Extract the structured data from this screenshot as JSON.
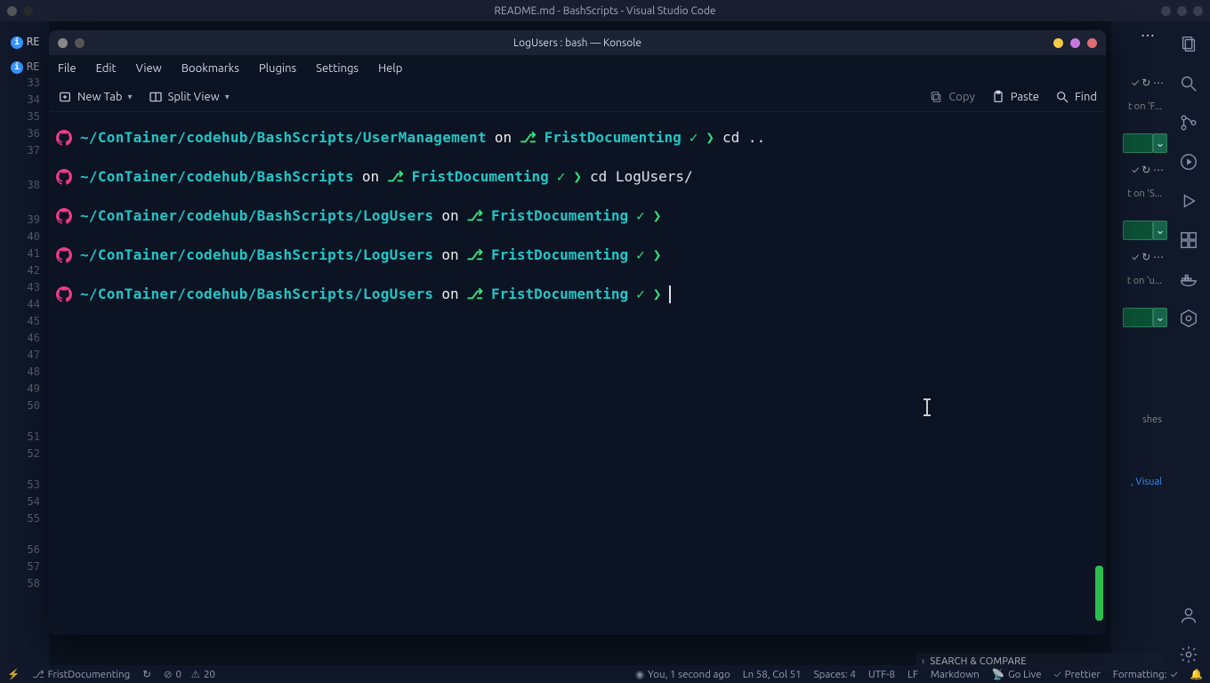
{
  "vscode": {
    "title": "README.md - BashScripts - Visual Studio Code",
    "tab1": "RE",
    "tab2": "RE",
    "more": "⋯"
  },
  "konsole": {
    "title": "LogUsers : bash — Konsole",
    "menu": [
      "File",
      "Edit",
      "View",
      "Bookmarks",
      "Plugins",
      "Settings",
      "Help"
    ],
    "toolbar": {
      "newtab": "New Tab",
      "split": "Split View",
      "copy": "Copy",
      "paste": "Paste",
      "find": "Find"
    },
    "prompts": [
      {
        "path": "~/ConTainer/codehub/BashScripts/UserManagement",
        "branch": "FristDocumenting",
        "cmd": "cd .."
      },
      {
        "path": "~/ConTainer/codehub/BashScripts",
        "branch": "FristDocumenting",
        "cmd": "cd LogUsers/"
      },
      {
        "path": "~/ConTainer/codehub/BashScripts/LogUsers",
        "branch": "FristDocumenting",
        "cmd": ""
      },
      {
        "path": "~/ConTainer/codehub/BashScripts/LogUsers",
        "branch": "FristDocumenting",
        "cmd": ""
      },
      {
        "path": "~/ConTainer/codehub/BashScripts/LogUsers",
        "branch": "FristDocumenting",
        "cmd": "",
        "cursor": true
      }
    ]
  },
  "line_numbers": [
    33,
    34,
    35,
    36,
    37,
    38,
    39,
    40,
    41,
    42,
    43,
    44,
    45,
    46,
    47,
    48,
    49,
    50,
    51,
    52,
    53,
    54,
    55,
    56,
    57,
    58
  ],
  "right_panel": {
    "f1": "t on 'F...",
    "f2": "t on 'S...",
    "f3": "t on 'u...",
    "shes": "shes",
    "visual": ", Visual",
    "search": "SEARCH & COMPARE"
  },
  "statusbar": {
    "branch": "FristDocumenting",
    "sync": "↻",
    "errors": "0",
    "warnings": "20",
    "blame": "You, 1 second ago",
    "pos": "Ln 58, Col 51",
    "spaces": "Spaces: 4",
    "enc": "UTF-8",
    "eol": "LF",
    "lang": "Markdown",
    "golive": "Go Live",
    "prettier": "Prettier",
    "formatting": "Formatting:"
  }
}
